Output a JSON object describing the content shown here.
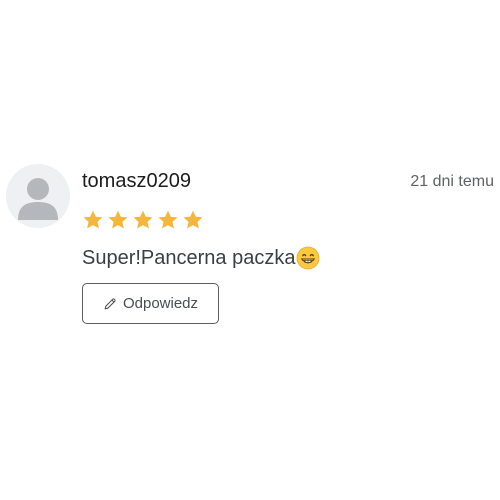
{
  "review": {
    "username": "tomasz0209",
    "date": "21 dni temu",
    "rating": 5,
    "rating_max": 5,
    "comment": "Super!Pancerna paczka",
    "emoji": "grinning-face-emoji",
    "reply_button_label": "Odpowiedz",
    "icons": {
      "avatar": "user-avatar-icon",
      "star": "star-icon",
      "reply": "pencil-icon"
    }
  },
  "colors": {
    "star": "#f5b73b",
    "text": "#1d1d1d",
    "muted": "#5e6166",
    "avatar_bg": "#eef0f2",
    "avatar_fg": "#b4b8bd",
    "button_border": "#5a5d62"
  }
}
